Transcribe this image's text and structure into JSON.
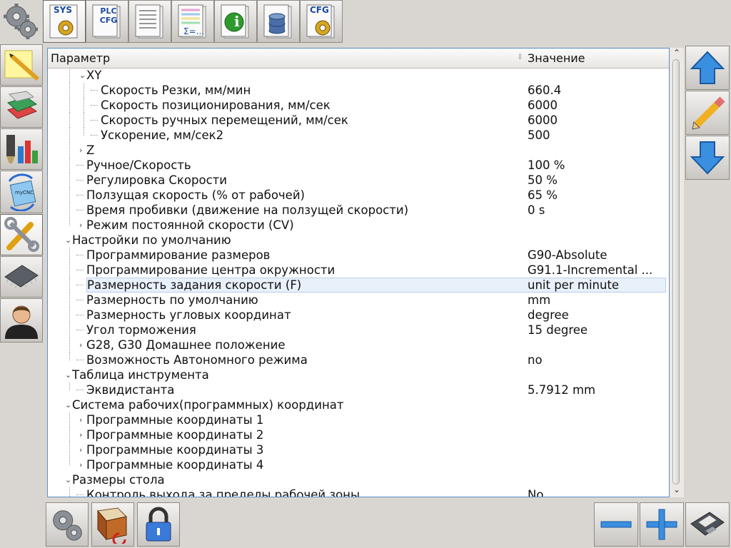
{
  "top_tabs": [
    {
      "name": "sys-tab",
      "label": "SYS"
    },
    {
      "name": "plc-cfg-tab",
      "label": "PLC CFG"
    },
    {
      "name": "document-tab",
      "label": ""
    },
    {
      "name": "formula-tab",
      "label": "Σ=..."
    },
    {
      "name": "info-tab",
      "label": "i"
    },
    {
      "name": "database-tab",
      "label": ""
    },
    {
      "name": "cfg-tab",
      "label": "CFG"
    }
  ],
  "sidebar_label_mycnc": "myCNC",
  "table": {
    "col_param": "Параметр",
    "col_value": "Значение",
    "rows": [
      {
        "label": "XY",
        "value": "",
        "level": 1,
        "exp": "open"
      },
      {
        "label": "Скорость Резки, мм/мин",
        "value": "660.4",
        "level": 2
      },
      {
        "label": "Скорость позиционирования, мм/сек",
        "value": "6000",
        "level": 2
      },
      {
        "label": "Скорость ручных перемещений, мм/сек",
        "value": "6000",
        "level": 2
      },
      {
        "label": "Ускорение, мм/сек2",
        "value": "500",
        "level": 2,
        "last": true
      },
      {
        "label": "Z",
        "value": "",
        "level": 1,
        "exp": "closed"
      },
      {
        "label": "Ручное/Скорость",
        "value": "100 %",
        "level": 1
      },
      {
        "label": "Регулировка Скорости",
        "value": "50 %",
        "level": 1
      },
      {
        "label": "Ползущая скорость (% от рабочей)",
        "value": "65 %",
        "level": 1
      },
      {
        "label": "Время пробивки (движение на ползущей скорости)",
        "value": "0 s",
        "level": 1
      },
      {
        "label": "Режим постоянной скорости (CV)",
        "value": "",
        "level": 1,
        "exp": "closed",
        "last": true
      },
      {
        "label": "Настройки по умолчанию",
        "value": "",
        "level": 0,
        "exp": "open"
      },
      {
        "label": "Программирование размеров",
        "value": "G90-Absolute",
        "level": 1
      },
      {
        "label": "Программирование центра окружности",
        "value": "G91.1-Incremental ...",
        "level": 1
      },
      {
        "label": "Размерность задания скорости (F)",
        "value": "unit per minute",
        "level": 1,
        "selected": true
      },
      {
        "label": "Размерность по умолчанию",
        "value": "mm",
        "level": 1
      },
      {
        "label": "Размерность угловых координат",
        "value": "degree",
        "level": 1
      },
      {
        "label": "Угол торможения",
        "value": "15 degree",
        "level": 1
      },
      {
        "label": "G28, G30 Домашнее положение",
        "value": "",
        "level": 1,
        "exp": "closed"
      },
      {
        "label": "Возможность Автономного режима",
        "value": "no",
        "level": 1,
        "last": true
      },
      {
        "label": "Таблица инструмента",
        "value": "",
        "level": 0,
        "exp": "open"
      },
      {
        "label": "Эквидистанта",
        "value": "5.7912  mm",
        "level": 1,
        "last": true
      },
      {
        "label": "Система рабочих(программных) координат",
        "value": "",
        "level": 0,
        "exp": "open"
      },
      {
        "label": "Программные координаты 1",
        "value": "",
        "level": 1,
        "exp": "closed"
      },
      {
        "label": "Программные координаты 2",
        "value": "",
        "level": 1,
        "exp": "closed"
      },
      {
        "label": "Программные координаты 3",
        "value": "",
        "level": 1,
        "exp": "closed"
      },
      {
        "label": "Программные координаты 4",
        "value": "",
        "level": 1,
        "exp": "closed",
        "last": true
      },
      {
        "label": "Размеры стола",
        "value": "",
        "level": 0,
        "exp": "open"
      },
      {
        "label": "Контроль выхода за пределы рабочей зоны",
        "value": "No",
        "level": 1
      }
    ]
  },
  "colors": {
    "accent": "#3a8fe0",
    "frame": "#5a8fc7"
  }
}
